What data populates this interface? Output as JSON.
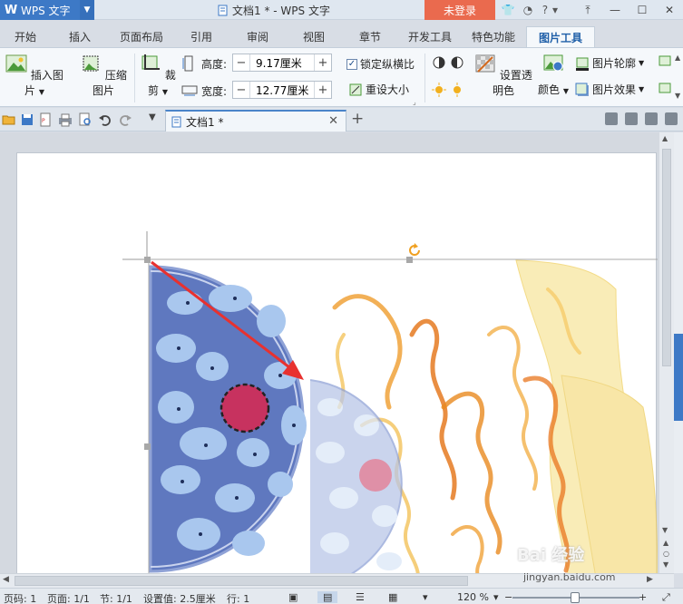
{
  "app": {
    "logo_letter": "W",
    "name": "WPS 文字",
    "window_title": "文档1 * - WPS 文字",
    "login_label": "未登录",
    "help_label": "?"
  },
  "tabs": [
    {
      "label": "开始"
    },
    {
      "label": "插入"
    },
    {
      "label": "页面布局"
    },
    {
      "label": "引用"
    },
    {
      "label": "审阅"
    },
    {
      "label": "视图"
    },
    {
      "label": "章节"
    },
    {
      "label": "开发工具"
    },
    {
      "label": "特色功能"
    },
    {
      "label": "图片工具",
      "active": true
    }
  ],
  "ribbon": {
    "insert_picture": "插入图片",
    "compress_picture": "压缩图片",
    "crop": "裁剪",
    "height_label": "高度:",
    "height_value": "9.17厘米",
    "width_label": "宽度:",
    "width_value": "12.77厘米",
    "lock_ratio": "锁定纵横比",
    "reset_size": "重设大小",
    "set_transparent": "设置透明色",
    "color": "颜色",
    "picture_outline": "图片轮廓",
    "picture_effect": "图片效果"
  },
  "doctab": {
    "name": "文档1 *"
  },
  "status": {
    "page_no": "页码: 1",
    "pages": "页面: 1/1",
    "section": "节: 1/1",
    "set_value": "设置值: 2.5厘米",
    "row": "行: 1",
    "zoom": "120 %"
  },
  "watermark": {
    "text": "Bai 经验",
    "url": "jingyan.baidu.com"
  },
  "colors": {
    "accent": "#3d79c6",
    "login": "#ea6a4e",
    "cell_blue": "#5f78bf",
    "nucleus": "#c7325f",
    "arrow": "#e8312f"
  }
}
